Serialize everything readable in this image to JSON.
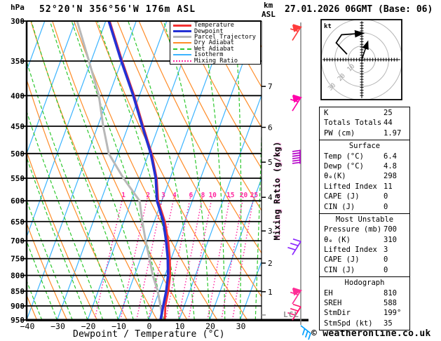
{
  "header": {
    "pressure_unit": "hPa",
    "title": "52°20'N 356°56'W 176m ASL",
    "km_unit": "km",
    "asl_unit": "ASL",
    "datetime": "27.01.2026 06GMT (Base: 06)"
  },
  "legend": {
    "items": [
      {
        "label": "Temperature",
        "color": "#f43131",
        "style": "thick"
      },
      {
        "label": "Dewpoint",
        "color": "#2431d4",
        "style": "thick"
      },
      {
        "label": "Parcel Trajectory",
        "color": "#b8b8b8",
        "style": "thick"
      },
      {
        "label": "Dry Adiabat",
        "color": "#ff8c28",
        "style": "thin"
      },
      {
        "label": "Wet Adiabat",
        "color": "#2ec82e",
        "style": "dashed"
      },
      {
        "label": "Isotherm",
        "color": "#3cb4ff",
        "style": "thin"
      },
      {
        "label": "Mixing Ratio",
        "color": "#ff28a0",
        "style": "dotted"
      }
    ]
  },
  "axes": {
    "pressure_ticks": [
      300,
      350,
      400,
      450,
      500,
      550,
      600,
      650,
      700,
      750,
      800,
      850,
      900,
      950
    ],
    "temp_ticks": [
      -40,
      -30,
      -20,
      -10,
      0,
      10,
      20,
      30
    ],
    "x_label": "Dewpoint / Temperature (°C)",
    "km_ticks": [
      {
        "km": 7,
        "p": 386
      },
      {
        "km": 6,
        "p": 452
      },
      {
        "km": 5,
        "p": 517
      },
      {
        "km": 4,
        "p": 592
      },
      {
        "km": 3,
        "p": 674
      },
      {
        "km": 2,
        "p": 763
      },
      {
        "km": 1,
        "p": 852
      }
    ],
    "lcl_label": "LCL",
    "lcl_pressure": 932,
    "mixing_axis_label": "Mixing Ratio (g/kg)",
    "mixing_values": [
      1,
      2,
      3,
      4,
      6,
      8,
      10,
      15,
      20,
      25
    ]
  },
  "chart_data": {
    "type": "skew-t-log-p",
    "pressure_range": [
      300,
      950
    ],
    "surface_temp_range": [
      -40,
      37
    ],
    "series": [
      {
        "name": "Temperature",
        "color": "#f43131",
        "width": 2.8,
        "points": [
          [
            950,
            5.3
          ],
          [
            900,
            3.8
          ],
          [
            850,
            3.0
          ],
          [
            800,
            1.7
          ],
          [
            750,
            -0.4
          ],
          [
            700,
            -3.1
          ],
          [
            650,
            -6.5
          ],
          [
            600,
            -11.2
          ],
          [
            550,
            -14.4
          ],
          [
            500,
            -19.0
          ],
          [
            450,
            -25.1
          ],
          [
            400,
            -31.7
          ],
          [
            350,
            -39.8
          ],
          [
            300,
            -48.7
          ]
        ]
      },
      {
        "name": "Dewpoint",
        "color": "#2431d4",
        "width": 3.6,
        "points": [
          [
            950,
            3.9
          ],
          [
            900,
            3.1
          ],
          [
            850,
            2.3
          ],
          [
            800,
            1.0
          ],
          [
            750,
            -1.1
          ],
          [
            700,
            -3.8
          ],
          [
            650,
            -7.0
          ],
          [
            600,
            -11.6
          ],
          [
            550,
            -14.7
          ],
          [
            500,
            -19.3
          ],
          [
            450,
            -25.4
          ],
          [
            400,
            -32.0
          ],
          [
            350,
            -40.1
          ],
          [
            300,
            -49.0
          ]
        ]
      },
      {
        "name": "Parcel Trajectory",
        "color": "#b8b8b8",
        "width": 3.0,
        "points": [
          [
            950,
            4.6
          ],
          [
            900,
            2.2
          ],
          [
            850,
            -0.5
          ],
          [
            800,
            -4.0
          ],
          [
            750,
            -7.1
          ],
          [
            700,
            -10.5
          ],
          [
            650,
            -13.9
          ],
          [
            600,
            -17.3
          ],
          [
            550,
            -25.3
          ],
          [
            500,
            -33.1
          ],
          [
            450,
            -38.2
          ],
          [
            400,
            -43.3
          ],
          [
            350,
            -50.7
          ],
          [
            300,
            -59.4
          ]
        ]
      }
    ],
    "wind_barbs": [
      {
        "p": 307,
        "color": "#ff3b3b",
        "type": "barb",
        "fl": 2,
        "flag": true
      },
      {
        "p": 403,
        "color": "#ff00aa",
        "type": "barb",
        "fl": 2,
        "flag": true
      },
      {
        "p": 505,
        "color": "#b400c8",
        "type": "comb"
      },
      {
        "p": 702,
        "color": "#8c28ff",
        "type": "barb",
        "fl": 3,
        "flag": false
      },
      {
        "p": 848,
        "color": "#ff2d96",
        "type": "barb",
        "fl": 2,
        "flag": true
      },
      {
        "p": 903,
        "color": "#ff0f6e",
        "type": "barb",
        "fl": 3,
        "flag": false
      },
      {
        "p": 958,
        "color": "#00a0ff",
        "type": "down"
      }
    ],
    "hodograph": {
      "unit": "kt",
      "ring_labels": [
        10,
        20,
        30
      ],
      "trace_kt": [
        [
          -11,
          4
        ],
        [
          -19,
          12.5
        ],
        [
          -15,
          18.5
        ],
        [
          -0.5,
          19.5
        ]
      ],
      "storm_vector_kt": [
        [
          0,
          0
        ],
        [
          4,
          12
        ]
      ]
    }
  },
  "stats_table": {
    "sections": [
      {
        "title": "",
        "rows": [
          [
            "K",
            "25"
          ],
          [
            "Totals Totals",
            "44"
          ],
          [
            "PW (cm)",
            "1.97"
          ]
        ]
      },
      {
        "title": "Surface",
        "rows": [
          [
            "Temp (°C)",
            "6.4"
          ],
          [
            "Dewp (°C)",
            "4.8"
          ],
          [
            "θₑ(K)",
            "298"
          ],
          [
            "Lifted Index",
            "11"
          ],
          [
            "CAPE (J)",
            "0"
          ],
          [
            "CIN (J)",
            "0"
          ]
        ]
      },
      {
        "title": "Most Unstable",
        "rows": [
          [
            "Pressure (mb)",
            "700"
          ],
          [
            "θₑ (K)",
            "310"
          ],
          [
            "Lifted Index",
            "3"
          ],
          [
            "CAPE (J)",
            "0"
          ],
          [
            "CIN (J)",
            "0"
          ]
        ]
      },
      {
        "title": "Hodograph",
        "rows": [
          [
            "EH",
            "810"
          ],
          [
            "SREH",
            "588"
          ],
          [
            "StmDir",
            "199°"
          ],
          [
            "StmSpd (kt)",
            "35"
          ]
        ]
      }
    ]
  },
  "footer": "© weatheronline.co.uk"
}
